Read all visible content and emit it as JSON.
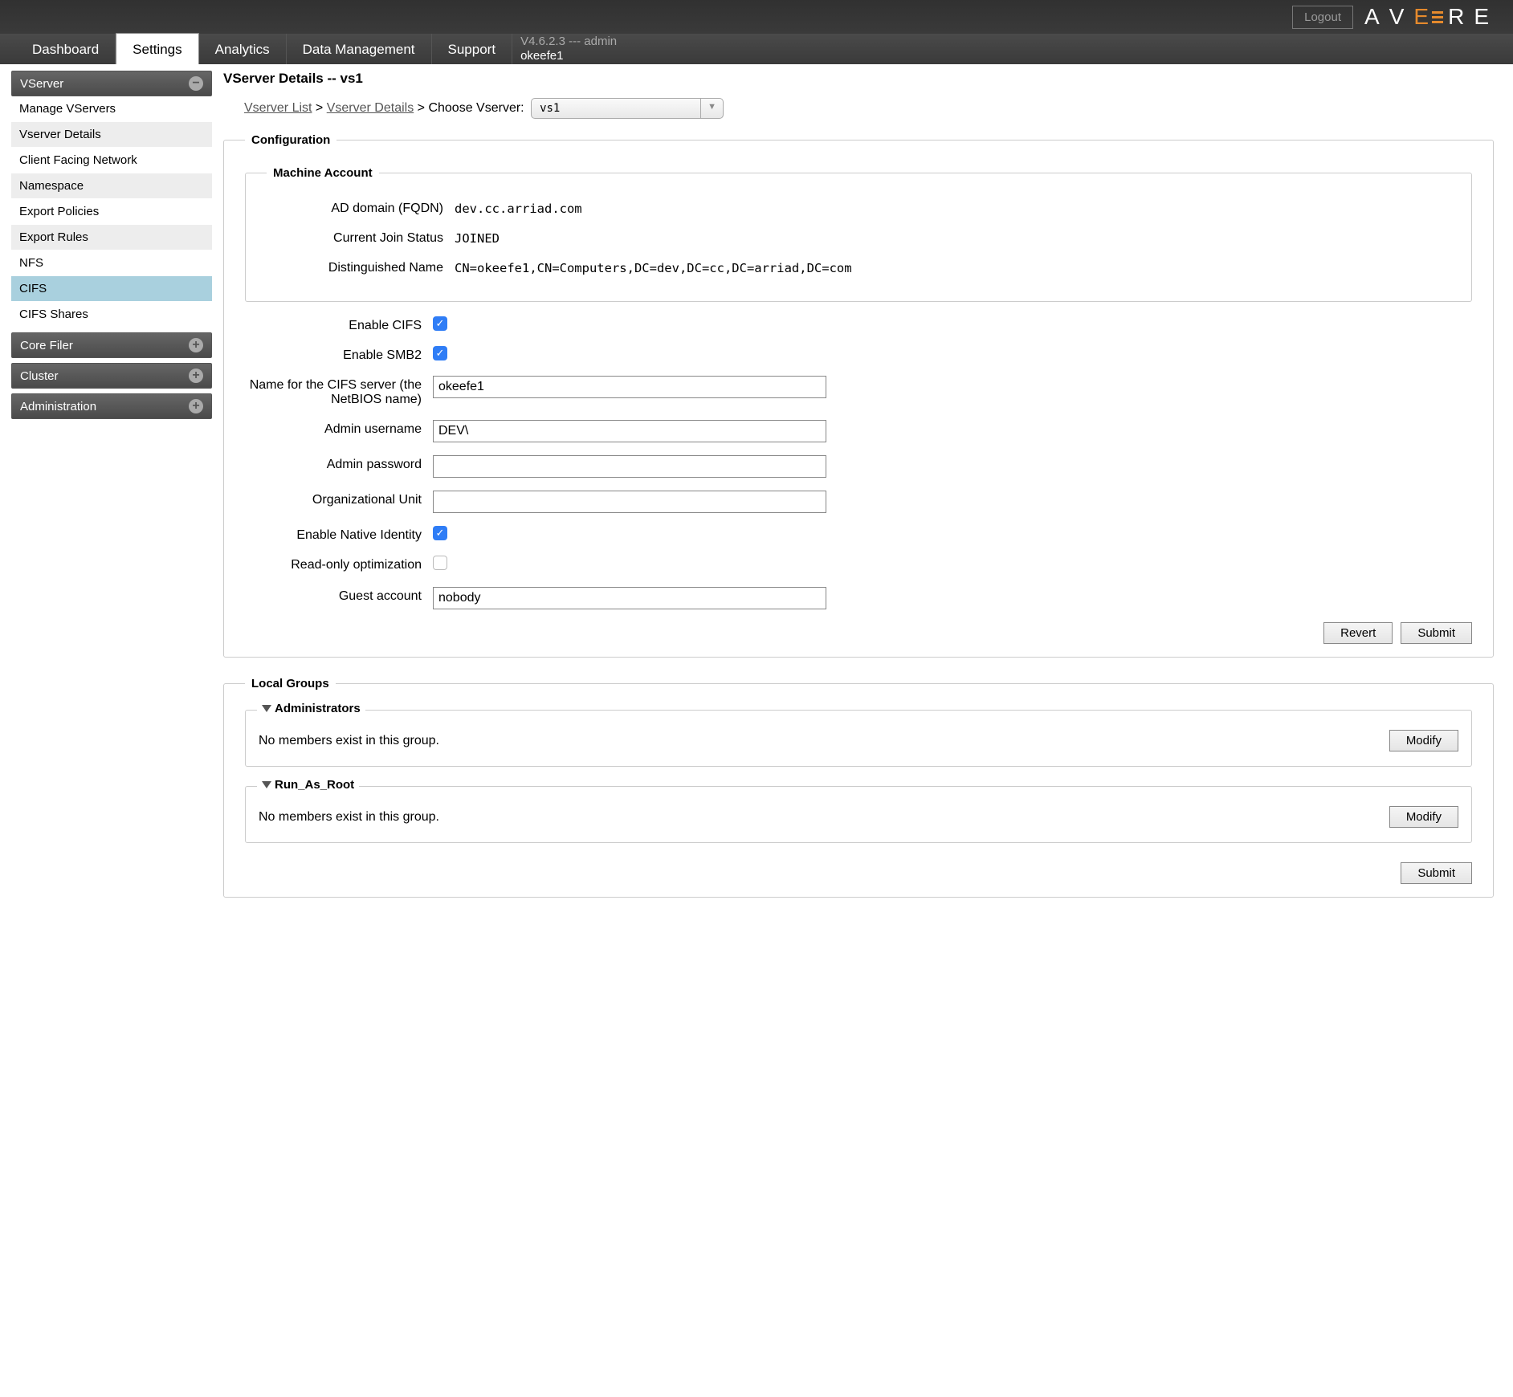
{
  "header": {
    "logout": "Logout",
    "version_line": "V4.6.2.3 --- admin",
    "user": "okeefe1",
    "logo_letters": [
      "A",
      "V",
      "E",
      "R",
      "E"
    ]
  },
  "tabs": [
    "Dashboard",
    "Settings",
    "Analytics",
    "Data Management",
    "Support"
  ],
  "sidebar": {
    "sections": [
      {
        "title": "VServer",
        "icon": "minus",
        "items": [
          "Manage VServers",
          "Vserver Details",
          "Client Facing Network",
          "Namespace",
          "Export Policies",
          "Export Rules",
          "NFS",
          "CIFS",
          "CIFS Shares"
        ]
      },
      {
        "title": "Core Filer",
        "icon": "plus",
        "items": []
      },
      {
        "title": "Cluster",
        "icon": "plus",
        "items": []
      },
      {
        "title": "Administration",
        "icon": "plus",
        "items": []
      }
    ]
  },
  "page": {
    "title": "VServer Details -- vs1",
    "breadcrumb": {
      "vserver_list": "Vserver List",
      "vserver_details": "Vserver Details",
      "choose_label": "Choose Vserver:",
      "selected": "vs1",
      "sep": " > "
    }
  },
  "config": {
    "legend": "Configuration",
    "machine_account": {
      "legend": "Machine Account",
      "rows": {
        "ad_domain_label": "AD domain (FQDN)",
        "ad_domain_value": "dev.cc.arriad.com",
        "join_status_label": "Current Join Status",
        "join_status_value": "JOINED",
        "dn_label": "Distinguished Name",
        "dn_value": "CN=okeefe1,CN=Computers,DC=dev,DC=cc,DC=arriad,DC=com"
      }
    },
    "fields": {
      "enable_cifs_label": "Enable CIFS",
      "enable_cifs": true,
      "enable_smb2_label": "Enable SMB2",
      "enable_smb2": true,
      "netbios_label": "Name for the CIFS server (the NetBIOS name)",
      "netbios_value": "okeefe1",
      "admin_user_label": "Admin username",
      "admin_user_value": "DEV\\",
      "admin_pass_label": "Admin password",
      "admin_pass_value": "",
      "ou_label": "Organizational Unit",
      "ou_value": "",
      "native_identity_label": "Enable Native Identity",
      "native_identity": true,
      "readonly_label": "Read-only optimization",
      "readonly": false,
      "guest_label": "Guest account",
      "guest_value": "nobody"
    },
    "buttons": {
      "revert": "Revert",
      "submit": "Submit"
    }
  },
  "local_groups": {
    "legend": "Local Groups",
    "groups": [
      {
        "name": "Administrators",
        "empty_msg": "No members exist in this group.",
        "modify": "Modify"
      },
      {
        "name": "Run_As_Root",
        "empty_msg": "No members exist in this group.",
        "modify": "Modify"
      }
    ],
    "submit": "Submit"
  }
}
